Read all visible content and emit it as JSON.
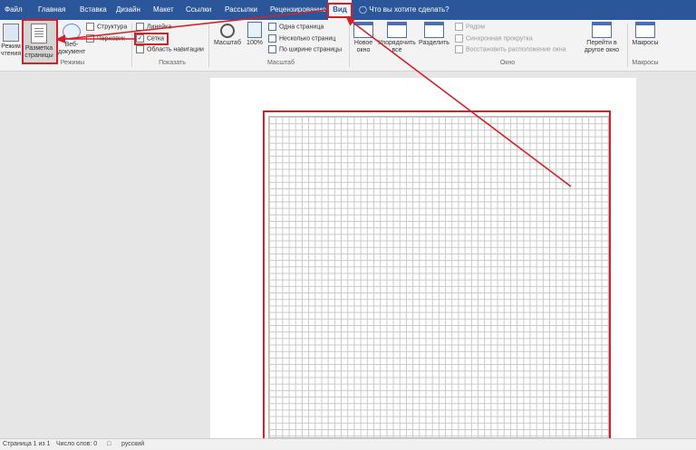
{
  "tabs": [
    "Файл",
    "Главная",
    "Вставка",
    "Дизайн",
    "Макет",
    "Ссылки",
    "Рассылки",
    "Рецензирование",
    "Вид"
  ],
  "search_text": "Что вы хотите сделать?",
  "ribbon": {
    "views": {
      "read_mode": "Режим чтения",
      "print_layout": "Разметка страницы",
      "web_layout": "Веб-документ",
      "outline": "Структура",
      "draft": "Черновик",
      "group_label": "Режимы"
    },
    "show": {
      "ruler": "Линейка",
      "gridlines": "Сетка",
      "navigation": "Область навигации",
      "group_label": "Показать",
      "gridlines_checked": true
    },
    "zoom": {
      "zoom": "Масштаб",
      "percent": "100%",
      "one_page": "Одна страница",
      "multiple_pages": "Несколько страниц",
      "page_width": "По ширине страницы",
      "group_label": "Масштаб"
    },
    "window": {
      "new_window": "Новое окно",
      "arrange_all": "Упорядочить все",
      "split": "Разделить",
      "side_by_side": "Рядом",
      "sync_scroll": "Синхронная прокрутка",
      "reset_position": "Восстановить расположение окна",
      "switch_windows": "Перейти в другое окно",
      "group_label": "Окно"
    },
    "macros": {
      "macros": "Макросы",
      "group_label": "Макросы"
    }
  },
  "status": {
    "page": "Страница 1 из 1",
    "words": "Число слов: 0",
    "language": "русский"
  },
  "colors": {
    "tab_bar": "#2b579a",
    "annotation": "#d3202a"
  }
}
